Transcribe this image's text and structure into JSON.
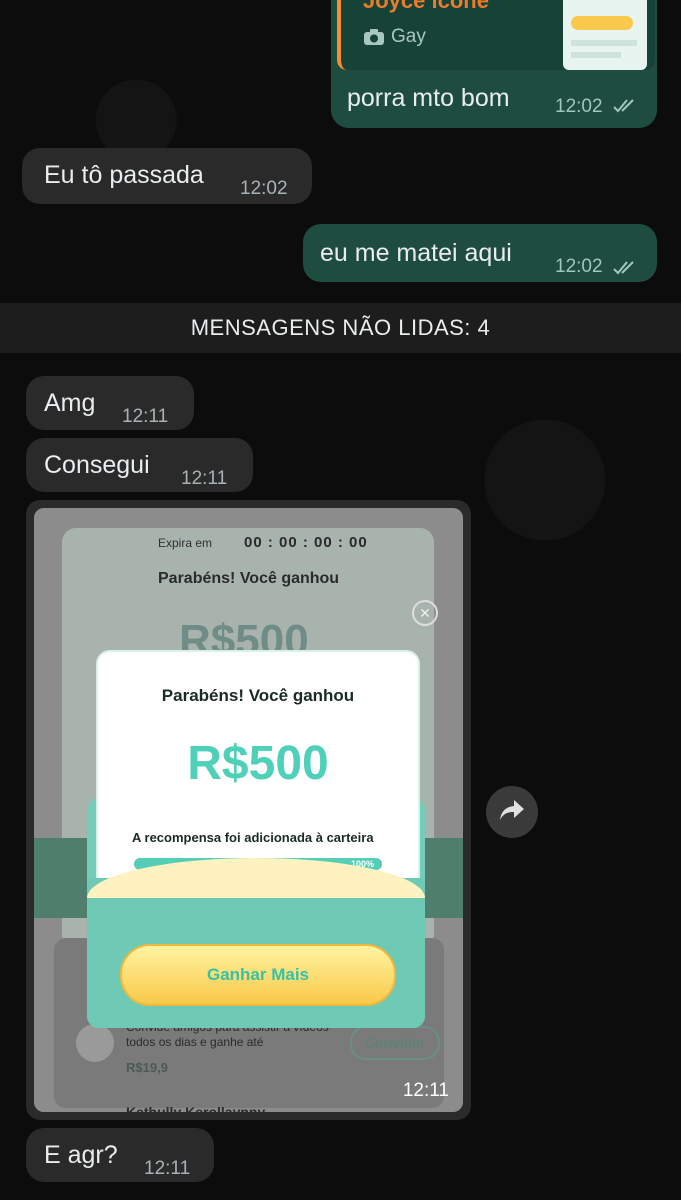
{
  "quoted": {
    "name": "Joyce icone",
    "media_label": "Gay",
    "message": "porra mto bom",
    "time": "12:02"
  },
  "messages": [
    {
      "text": "Eu tô passada",
      "time": "12:02"
    },
    {
      "text": "eu me matei aqui",
      "time": "12:02"
    },
    {
      "text": "Amg",
      "time": "12:11"
    },
    {
      "text": "Consegui",
      "time": "12:11"
    },
    {
      "text": "E agr?",
      "time": "12:11"
    }
  ],
  "unread_divider": "MENSAGENS NÃO LIDAS: 4",
  "image_message": {
    "time": "12:11",
    "screenshot": {
      "expira_label": "Expira em",
      "timer": "00 : 00 : 00 : 00",
      "bg_title": "Parabéns! Você ganhou",
      "bg_amount": "R$500",
      "modal_title": "Parabéns! Você ganhou",
      "modal_amount": "R$500",
      "modal_caption": "A recompensa foi adicionada à carteira",
      "progress_label": "100%",
      "progress_fraction": 1.0,
      "cta": "Ganhar Mais",
      "invite_text": "Convide amigos para assistir a vídeos todos os dias e ganhe até",
      "invite_amount": "R$19,9",
      "invite_button": "Convidar",
      "bottom_name": "Kethully Kerollaynny"
    }
  },
  "colors": {
    "incoming": "#2a2a2a",
    "outgoing": "#1e4d40",
    "accent_teal": "#4fd0b8",
    "quote_bar": "#ff8b2c"
  }
}
